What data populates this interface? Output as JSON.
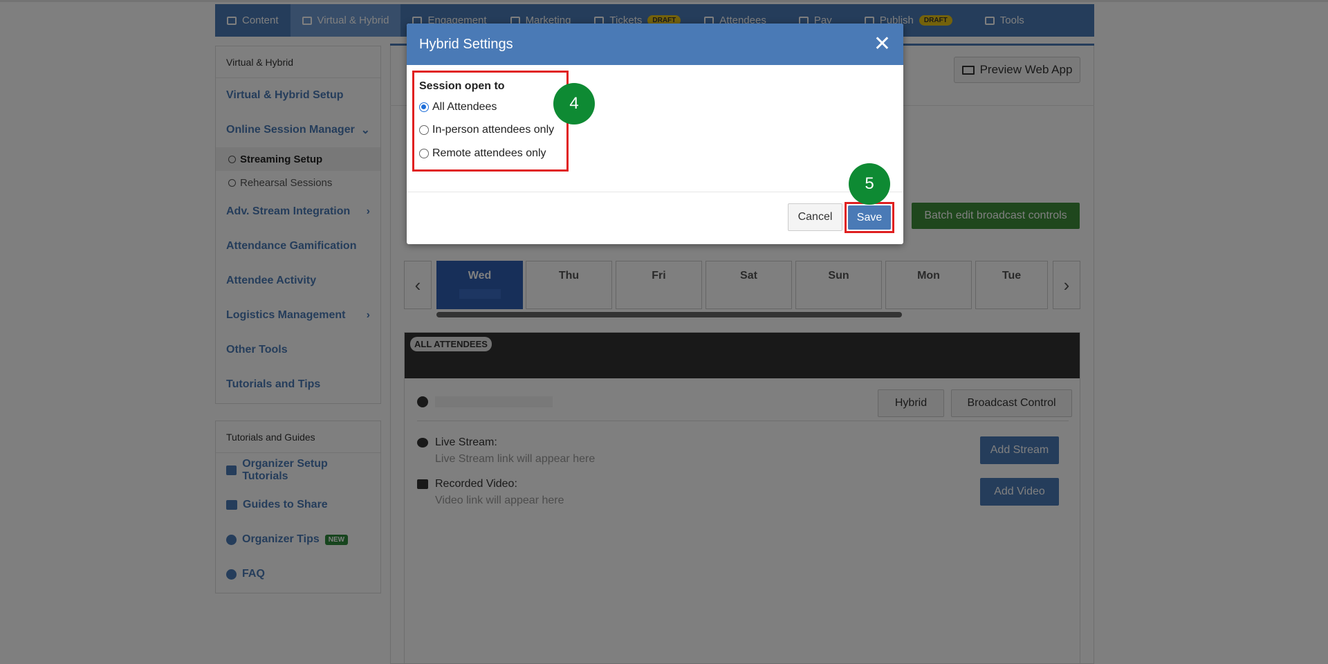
{
  "topnav": {
    "tabs": [
      {
        "label": "Content",
        "icon": "list-icon"
      },
      {
        "label": "Virtual & Hybrid",
        "icon": "laptop-icon"
      },
      {
        "label": "Engagement",
        "icon": "network-icon"
      },
      {
        "label": "Marketing",
        "icon": "bullhorn-icon"
      },
      {
        "label": "Tickets",
        "icon": "ticket-icon",
        "badge": "DRAFT"
      },
      {
        "label": "Attendees",
        "icon": "users-icon"
      },
      {
        "label": "Pay",
        "icon": "credit-card-icon"
      },
      {
        "label": "Publish",
        "icon": "cloud-upload-icon",
        "badge": "DRAFT"
      },
      {
        "label": "Tools",
        "icon": "toolbox-icon"
      }
    ]
  },
  "sidebar": {
    "heading": "Virtual & Hybrid",
    "items": [
      {
        "label": "Virtual & Hybrid Setup"
      },
      {
        "label": "Online Session Manager"
      },
      {
        "label": "Streaming Setup"
      },
      {
        "label": "Rehearsal Sessions"
      },
      {
        "label": "Adv. Stream Integration"
      },
      {
        "label": "Attendance Gamification"
      },
      {
        "label": "Attendee Activity"
      },
      {
        "label": "Logistics Management"
      },
      {
        "label": "Other Tools"
      },
      {
        "label": "Tutorials and Tips"
      }
    ]
  },
  "sidebar2": {
    "heading": "Tutorials and Guides",
    "items": [
      {
        "label": "Organizer Setup Tutorials"
      },
      {
        "label": "Guides to Share"
      },
      {
        "label": "Organizer Tips",
        "badge": "NEW"
      },
      {
        "label": "FAQ"
      }
    ]
  },
  "main": {
    "preview_label": "Preview Web App",
    "batch_label": "Batch edit broadcast controls",
    "days": [
      "Wed",
      "Thu",
      "Fri",
      "Sat",
      "Sun",
      "Mon",
      "Tue"
    ],
    "session": {
      "tag": "ALL ATTENDEES",
      "hybrid_label": "Hybrid",
      "broadcast_label": "Broadcast Control",
      "live_label": "Live Stream:",
      "live_hint": "Live Stream link will appear here",
      "add_stream_label": "Add Stream",
      "video_label": "Recorded Video:",
      "video_hint": "Video link will appear here",
      "add_video_label": "Add Video"
    }
  },
  "modal": {
    "title": "Hybrid Settings",
    "legend": "Session open to",
    "options": [
      {
        "label": "All Attendees",
        "checked": true
      },
      {
        "label": "In-person attendees only",
        "checked": false
      },
      {
        "label": "Remote attendees only",
        "checked": false
      }
    ],
    "cancel_label": "Cancel",
    "save_label": "Save"
  },
  "steps": [
    "4",
    "5"
  ],
  "colors": {
    "brand": "#4a7ab6",
    "highlight": "#e02020",
    "step_badge": "#0e8a33",
    "batch_green": "#3f8f3a"
  }
}
